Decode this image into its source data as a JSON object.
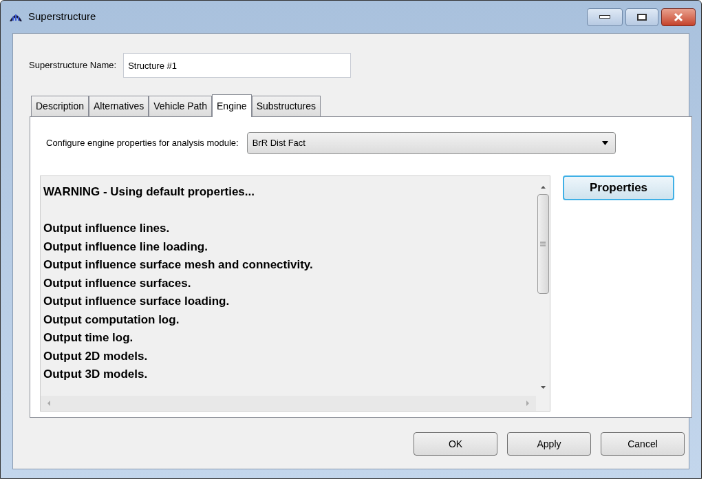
{
  "window": {
    "title": "Superstructure"
  },
  "name_field": {
    "label": "Superstructure Name:",
    "value": "Structure #1"
  },
  "tabs": [
    {
      "label": "Description",
      "selected": false
    },
    {
      "label": "Alternatives",
      "selected": false
    },
    {
      "label": "Vehicle Path",
      "selected": false
    },
    {
      "label": "Engine",
      "selected": true
    },
    {
      "label": "Substructures",
      "selected": false
    }
  ],
  "engine": {
    "module_label": "Configure engine properties for analysis module:",
    "module_value": "BrR Dist Fact",
    "log_warning": "WARNING - Using default properties...",
    "log_lines": [
      "Output influence lines.",
      "Output influence line loading.",
      "Output influence surface mesh and connectivity.",
      "Output influence surfaces.",
      "Output influence surface loading.",
      "Output computation log.",
      "Output time log.",
      "Output 2D models.",
      "Output 3D models."
    ],
    "properties_button": "Properties"
  },
  "buttons": [
    "OK",
    "Apply",
    "Cancel"
  ]
}
